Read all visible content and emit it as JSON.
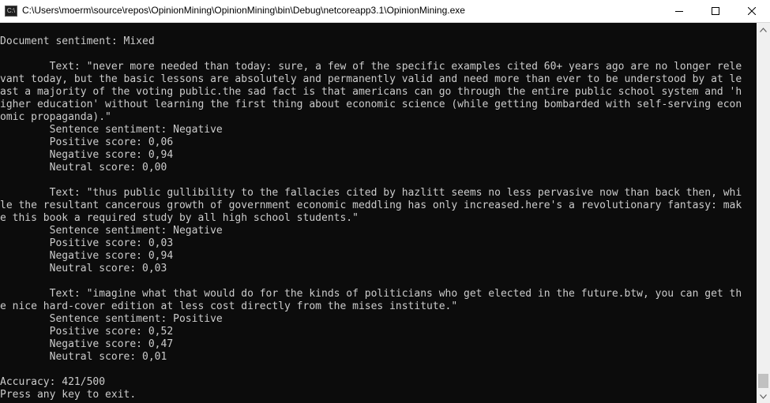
{
  "window": {
    "title": "C:\\Users\\moerm\\source\\repos\\OpinionMining\\OpinionMining\\bin\\Debug\\netcoreapp3.1\\OpinionMining.exe",
    "icon": "console-app-icon",
    "icon_text": "C:\\"
  },
  "controls": {
    "minimize": "minimize-icon",
    "maximize": "maximize-icon",
    "close": "close-icon"
  },
  "console": {
    "lines": [
      "Document sentiment: Mixed",
      "",
      "        Text: \"never more needed than today: sure, a few of the specific examples cited 60+ years ago are no longer rele",
      "vant today, but the basic lessons are absolutely and permanently valid and need more than ever to be understood by at le",
      "ast a majority of the voting public.the sad fact is that americans can go through the entire public school system and 'h",
      "igher education' without learning the first thing about economic science (while getting bombarded with self-serving econ",
      "omic propaganda).\"",
      "        Sentence sentiment: Negative",
      "        Positive score: 0,06",
      "        Negative score: 0,94",
      "        Neutral score: 0,00",
      "",
      "        Text: \"thus public gullibility to the fallacies cited by hazlitt seems no less pervasive now than back then, whi",
      "le the resultant cancerous growth of government economic meddling has only increased.here's a revolutionary fantasy: mak",
      "e this book a required study by all high school students.\"",
      "        Sentence sentiment: Negative",
      "        Positive score: 0,03",
      "        Negative score: 0,94",
      "        Neutral score: 0,03",
      "",
      "        Text: \"imagine what that would do for the kinds of politicians who get elected in the future.btw, you can get th",
      "e nice hard-cover edition at less cost directly from the mises institute.\"",
      "        Sentence sentiment: Positive",
      "        Positive score: 0,52",
      "        Negative score: 0,47",
      "        Neutral score: 0,01",
      "",
      "Accuracy: 421/500",
      "Press any key to exit."
    ]
  }
}
